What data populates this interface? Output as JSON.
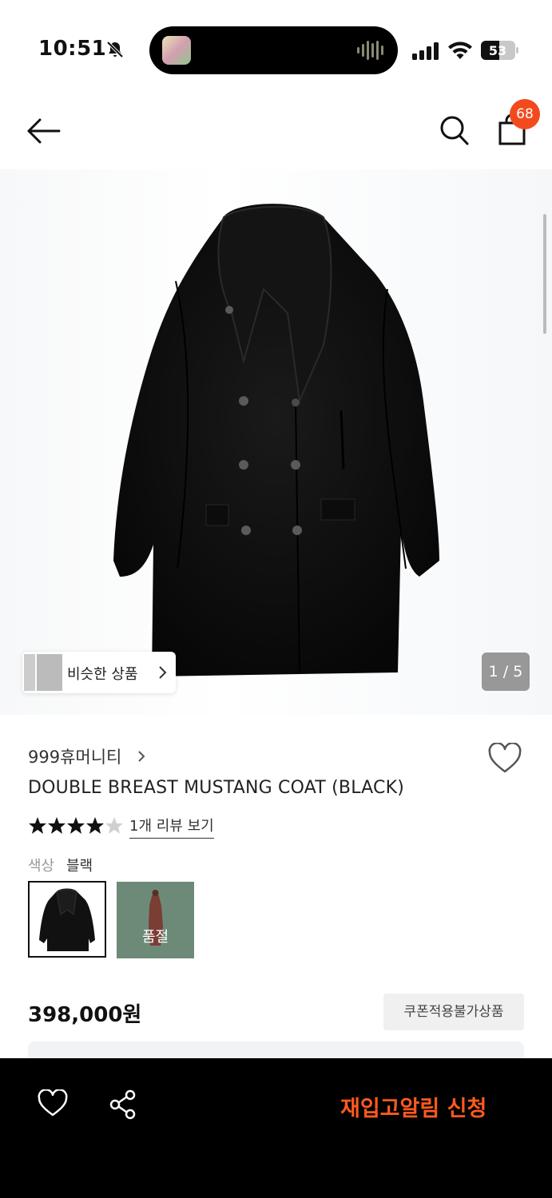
{
  "status": {
    "time": "10:51",
    "battery": "53",
    "icons": [
      "bell-muted-icon",
      "signal-icon",
      "wifi-icon",
      "battery-icon"
    ]
  },
  "nav": {
    "cart_count": "68",
    "icons": [
      "back-arrow-icon",
      "search-icon",
      "shopping-bag-icon"
    ]
  },
  "gallery": {
    "similar_label": "비슷한 상품",
    "counter": "1 / 5"
  },
  "product": {
    "brand": "999휴머니티",
    "name": "DOUBLE BREAST MUSTANG COAT (BLACK)",
    "rating": 4,
    "rating_max": 5,
    "review_link": "1개 리뷰 보기",
    "color_label": "색상",
    "color_value": "블랙",
    "swatches": [
      {
        "name": "블랙",
        "selected": true
      },
      {
        "name": "",
        "status": "품절"
      }
    ],
    "price": "398,000원",
    "coupon_badge": "쿠폰적용불가상품"
  },
  "bottom": {
    "restock_button": "재입고알림 신청"
  },
  "colors": {
    "accent": "#f24a1d",
    "restock": "#ff5a1f",
    "bottom_bar": "#000000",
    "swatch_green": "#6d8a78"
  }
}
